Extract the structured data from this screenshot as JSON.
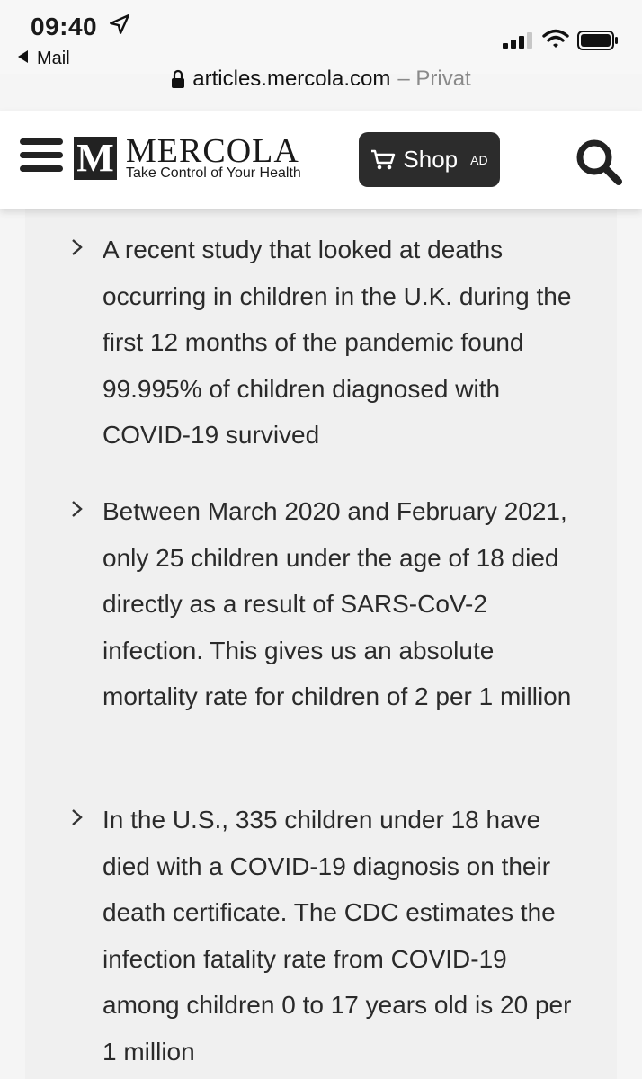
{
  "status_bar": {
    "time": "09:40",
    "back_label": "Mail"
  },
  "url_bar": {
    "domain": "articles.mercola.com",
    "mode": "– Privat"
  },
  "header": {
    "logo_letter": "M",
    "brand": "MERCOLA",
    "tagline": "Take Control of Your Health",
    "shop_label": "Shop",
    "ad_label": "AD"
  },
  "article": {
    "bullets": [
      {
        "text": "A recent study that looked at deaths occurring in children in the U.K. during the first 12 months of the pandemic found 99.995% of children diagnosed with COVID-19 survived"
      },
      {
        "text": "Between March 2020 and February 2021, only 25 children under the age of 18 died directly as a result of SARS-CoV-2 infection. This gives us an absolute mortality rate for children of 2 per 1 million"
      },
      {
        "text": "In the U.S., 335 children under 18 have died with a COVID-19 diagnosis on their death certificate. The CDC estimates the infection fatality rate from COVID-19 among children 0 to 17 years old is 20 per 1 million"
      }
    ]
  },
  "icons": {
    "location": "location-arrow-icon",
    "signal": "cellular-signal-icon",
    "wifi": "wifi-icon",
    "battery": "battery-icon",
    "lock": "lock-icon",
    "menu": "hamburger-menu-icon",
    "cart": "shopping-cart-icon",
    "search": "search-icon",
    "bullet": "chevron-right-icon"
  },
  "colors": {
    "shop_button": "#2c2c2c",
    "content_bg": "#f0f0f0",
    "text": "#2a2a2a"
  }
}
